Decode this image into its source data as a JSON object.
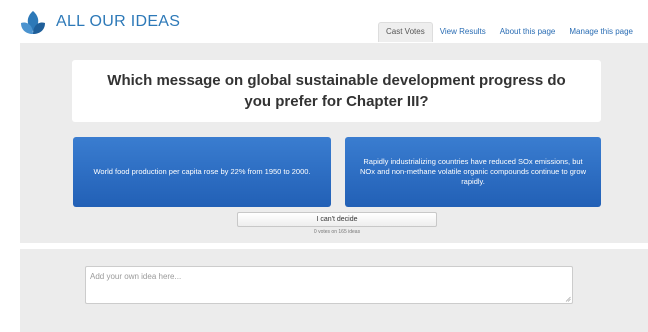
{
  "app": {
    "logo_icon": "petal-logo-icon",
    "logo_text": "ALL OUR IDEAS",
    "brand_color": "#2d79b8"
  },
  "nav": {
    "tabs": [
      {
        "label": "Cast Votes",
        "active": true
      },
      {
        "label": "View Results",
        "active": false
      },
      {
        "label": "About this page",
        "active": false
      },
      {
        "label": "Manage this page",
        "active": false
      }
    ]
  },
  "vote": {
    "question": "Which message on global sustainable development progress do you prefer for Chapter III?",
    "left_choice": "World food production per capita rose by 22% from 1950 to 2000.",
    "right_choice": "Rapidly industrializing countries have reduced SOx emissions, but NOx and non-methane volatile organic compounds continue to grow rapidly.",
    "cant_decide_label": "I can't decide",
    "vote_count": "0 votes on 165 ideas",
    "choice_color": "#2a6cc4"
  },
  "idea": {
    "placeholder": "Add your own idea here...",
    "value": ""
  }
}
